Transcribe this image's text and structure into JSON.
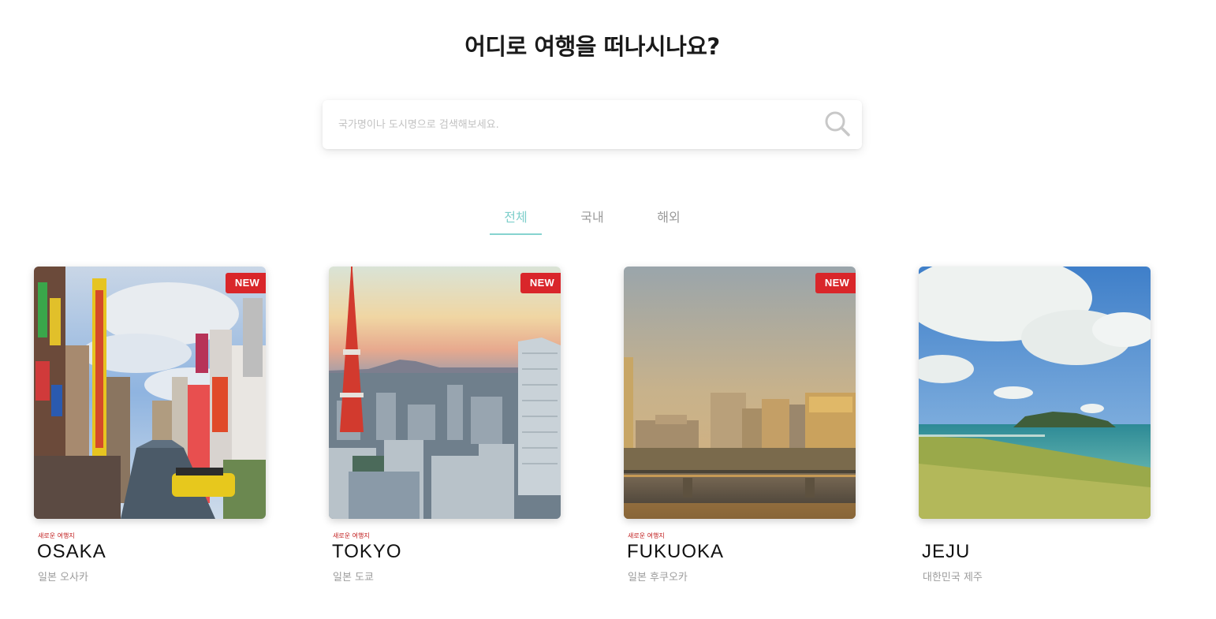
{
  "header": {
    "title": "어디로 여행을 떠나시나요?"
  },
  "search": {
    "placeholder": "국가명이나 도시명으로 검색해보세요.",
    "value": "",
    "icon": "search-icon"
  },
  "tabs": [
    {
      "label": "전체",
      "active": true
    },
    {
      "label": "국내",
      "active": false
    },
    {
      "label": "해외",
      "active": false
    }
  ],
  "colors": {
    "accent": "#86d3cf",
    "badge": "#d9262a",
    "tag": "#c01a1a"
  },
  "destinations": [
    {
      "badge": "NEW",
      "tag": "새로운 여행지",
      "name": "OSAKA",
      "sub": "일본 오사카"
    },
    {
      "badge": "NEW",
      "tag": "새로운 여행지",
      "name": "TOKYO",
      "sub": "일본 도쿄"
    },
    {
      "badge": "NEW",
      "tag": "새로운 여행지",
      "name": "FUKUOKA",
      "sub": "일본 후쿠오카"
    },
    {
      "badge": "",
      "tag": "",
      "name": "JEJU",
      "sub": "대한민국 제주"
    }
  ]
}
